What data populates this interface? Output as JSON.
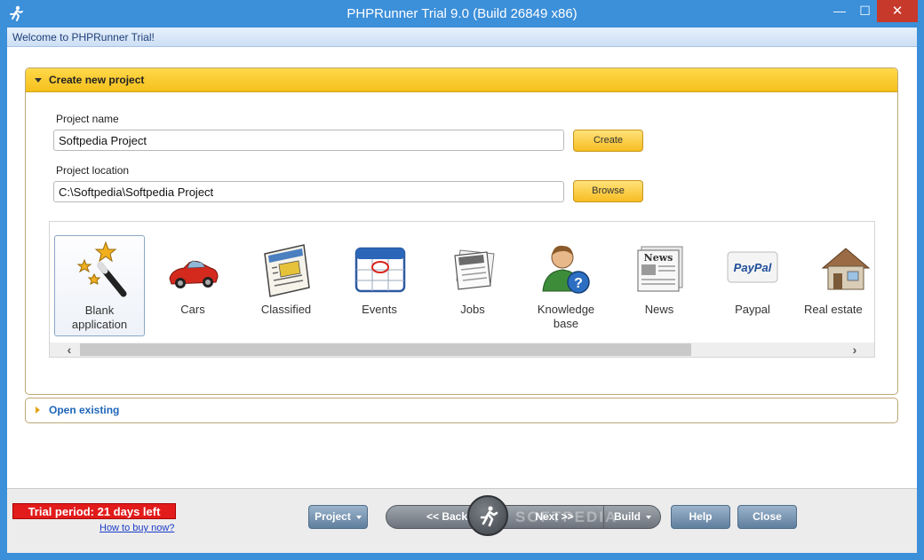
{
  "window": {
    "title": "PHPRunner Trial 9.0 (Build 26849 x86)",
    "minimize_glyph": "—",
    "maximize_glyph": "☐",
    "close_glyph": "✕",
    "app_icon": "runner-icon"
  },
  "welcome": {
    "text": "Welcome to PHPRunner Trial!"
  },
  "create_section": {
    "header": "Create new project",
    "project_name_label": "Project name",
    "project_name_value": "Softpedia Project",
    "create_button": "Create",
    "project_location_label": "Project location",
    "project_location_value": "C:\\Softpedia\\Softpedia Project",
    "browse_button": "Browse"
  },
  "templates": [
    {
      "line1": "Blank",
      "line2": "application",
      "icon": "magic-wand-icon",
      "selected": true
    },
    {
      "line1": "Cars",
      "line2": "",
      "icon": "car-icon",
      "selected": false
    },
    {
      "line1": "Classified",
      "line2": "",
      "icon": "newspaper-icon",
      "selected": false
    },
    {
      "line1": "Events",
      "line2": "",
      "icon": "calendar-icon",
      "selected": false
    },
    {
      "line1": "Jobs",
      "line2": "",
      "icon": "jobs-icon",
      "selected": false
    },
    {
      "line1": "Knowledge",
      "line2": "base",
      "icon": "help-user-icon",
      "selected": false
    },
    {
      "line1": "News",
      "line2": "",
      "icon": "news-icon",
      "selected": false
    },
    {
      "line1": "Paypal",
      "line2": "",
      "icon": "paypal-icon",
      "selected": false
    },
    {
      "line1": "Real estate",
      "line2": "",
      "icon": "house-icon",
      "selected": false
    }
  ],
  "paypal_logo_text": "PayPal",
  "open_section": {
    "header": "Open existing"
  },
  "footer": {
    "trial_text": "Trial period: 21 days left",
    "buy_link": "How to buy now?",
    "project_button": "Project",
    "back_button": "<< Back",
    "next_button": "Next >>",
    "build_button": "Build",
    "help_button": "Help",
    "close_button": "Close",
    "watermark": "SOFTPEDIA"
  },
  "colors": {
    "title_bar": "#3c8fd9",
    "section_header": "#f5c01c",
    "trial_badge": "#e21b1b",
    "nav_button": "#6f8fae"
  }
}
